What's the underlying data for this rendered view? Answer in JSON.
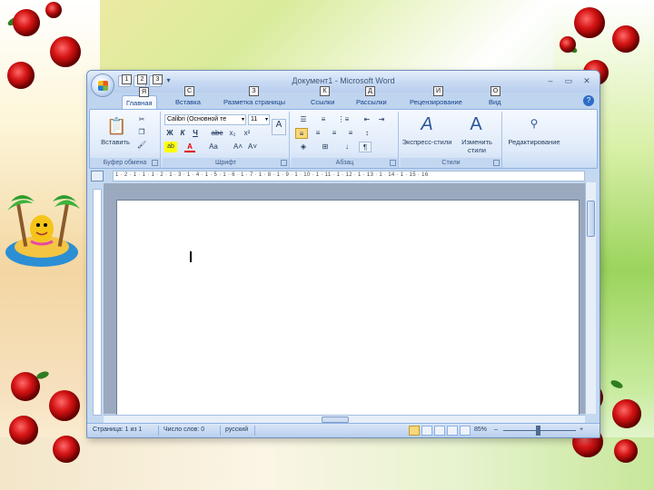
{
  "window": {
    "title": "Документ1 - Microsoft Word",
    "controls": [
      "–",
      "▭",
      "✕"
    ]
  },
  "qat": {
    "keytips": [
      "1",
      "2",
      "3"
    ]
  },
  "tabs": [
    {
      "label": "Главная",
      "active": true,
      "keytip": "Я"
    },
    {
      "label": "Вставка",
      "active": false,
      "keytip": "С"
    },
    {
      "label": "Разметка страницы",
      "active": false,
      "keytip": "З"
    },
    {
      "label": "Ссылки",
      "active": false,
      "keytip": "К"
    },
    {
      "label": "Рассылки",
      "active": false,
      "keytip": "Д"
    },
    {
      "label": "Рецензирование",
      "active": false,
      "keytip": "И"
    },
    {
      "label": "Вид",
      "active": false,
      "keytip": "О"
    }
  ],
  "ribbon": {
    "clipboard": {
      "label": "Буфер обмена",
      "paste": "Вставить"
    },
    "font": {
      "label": "Шрифт",
      "font_name": "Calibri (Основной те",
      "font_size": "11",
      "bold": "Ж",
      "italic": "К",
      "underline": "Ч",
      "strike": "abc",
      "sub": "x₂",
      "sup": "x²",
      "grow": "A˄",
      "shrink": "A˅",
      "case": "Aa"
    },
    "paragraph": {
      "label": "Абзац",
      "show_marks": "¶"
    },
    "styles": {
      "label": "Стили",
      "quick": "Экспресс-стили",
      "change": "Изменить стили"
    },
    "editing": {
      "label": "Редактирование"
    }
  },
  "ruler": {
    "text": "1 · 2 · 1 · 1 · 1 · 2 · 1 · 3 · 1 · 4 · 1 · 5 · 1 · 6 · 1 · 7 · 1 · 8 · 1 · 9 · 1 · 10 · 1 · 11 · 1 · 12 · 1 · 13 · 1 · 14 · 1 · 15 · 16"
  },
  "status": {
    "page": "Страница: 1 из 1",
    "words": "Число слов: 0",
    "language": "русский",
    "zoom": "85%",
    "zoom_out": "–",
    "zoom_in": "+"
  },
  "colors": {
    "accent": "#2b579a",
    "ribbon": "#dfeafa"
  }
}
